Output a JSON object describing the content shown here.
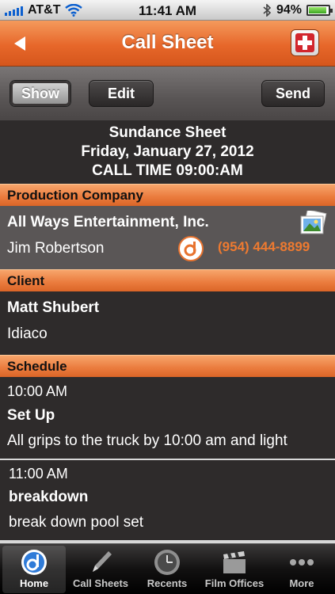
{
  "status": {
    "carrier": "AT&T",
    "time": "11:41 AM",
    "battery": "94%"
  },
  "nav": {
    "title": "Call Sheet"
  },
  "toolbar": {
    "show": "Show",
    "edit": "Edit",
    "send": "Send"
  },
  "sheet": {
    "name": "Sundance Sheet",
    "date": "Friday, January 27, 2012",
    "call_time": "CALL TIME 09:00:AM"
  },
  "production": {
    "header": "Production Company",
    "company": "All Ways Entertainment, Inc.",
    "contact": "Jim Robertson",
    "phone": "(954) 444-8899"
  },
  "client": {
    "header": "Client",
    "name": "Matt Shubert",
    "company": "Idiaco"
  },
  "schedule": {
    "header": "Schedule",
    "items": [
      {
        "time": "10:00 AM",
        "title": "Set Up",
        "note": "All grips to the truck by 10:00 am and light"
      },
      {
        "time": "11:00 AM",
        "title": "breakdown",
        "note": "break down pool set"
      }
    ]
  },
  "tabs": [
    {
      "label": "Home",
      "icon": "home-icon"
    },
    {
      "label": "Call Sheets",
      "icon": "pencil-icon"
    },
    {
      "label": "Recents",
      "icon": "clock-icon"
    },
    {
      "label": "Film Offices",
      "icon": "clapperboard-icon"
    },
    {
      "label": "More",
      "icon": "more-icon"
    }
  ],
  "colors": {
    "accent": "#e8732f",
    "panel": "#2e2b2b",
    "panel_light": "#5a5656"
  }
}
